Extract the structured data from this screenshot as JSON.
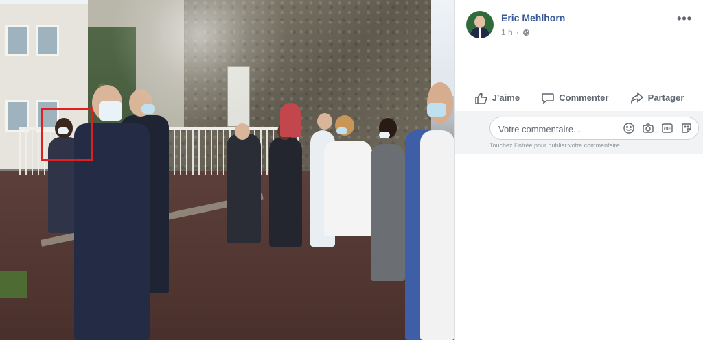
{
  "post": {
    "author": "Eric Mehlhorn",
    "time": "1 h",
    "privacy_icon": "globe-icon",
    "more_icon": "more-options-icon",
    "more_label": "•••"
  },
  "actions": {
    "like": "J’aime",
    "comment": "Commenter",
    "share": "Partager"
  },
  "comment_box": {
    "placeholder": "Votre commentaire...",
    "hint": "Touchez Entrée pour publier votre commentaire.",
    "icons": [
      "emoji-icon",
      "camera-icon",
      "gif-icon",
      "sticker-icon"
    ]
  },
  "photo": {
    "highlight_color": "#e02020"
  },
  "colors": {
    "author": "#385898",
    "action_text": "#606770",
    "comment_bg": "#f2f3f5"
  }
}
